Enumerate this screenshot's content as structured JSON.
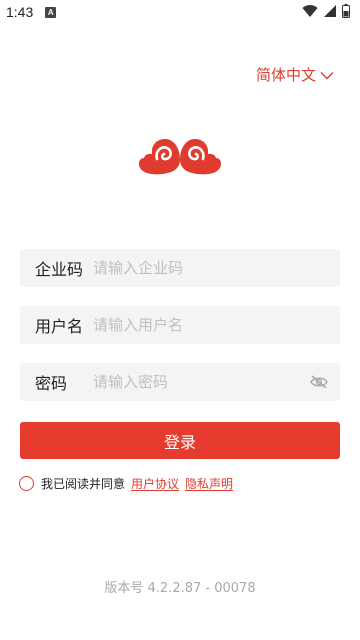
{
  "status_bar": {
    "time": "1:43",
    "notification_icon": "a-notification-icon",
    "icons": [
      "wifi-icon",
      "signal-icon",
      "battery-icon"
    ]
  },
  "language": {
    "label": "简体中文",
    "icon": "chevron-down-icon"
  },
  "logo": {
    "icon": "auspicious-cloud-logo",
    "color": "#e03b2f"
  },
  "form": {
    "company": {
      "label": "企业码",
      "placeholder": "请输入企业码",
      "value": ""
    },
    "username": {
      "label": "用户名",
      "placeholder": "请输入用户名",
      "value": ""
    },
    "password": {
      "label": "密码",
      "placeholder": "请输入密码",
      "value": "",
      "toggle_icon": "eye-hidden-icon"
    }
  },
  "login_button": {
    "label": "登录"
  },
  "agreement": {
    "text": "我已阅读并同意",
    "user_agreement": "用户协议",
    "privacy_statement": "隐私声明",
    "checked": false
  },
  "version": "版本号 4.2.2.87 - 00078",
  "colors": {
    "accent": "#e03b2f",
    "button": "#e63c30",
    "field_bg": "#f4f4f4",
    "placeholder": "#c0c0c0",
    "muted": "#a8a8a8"
  }
}
